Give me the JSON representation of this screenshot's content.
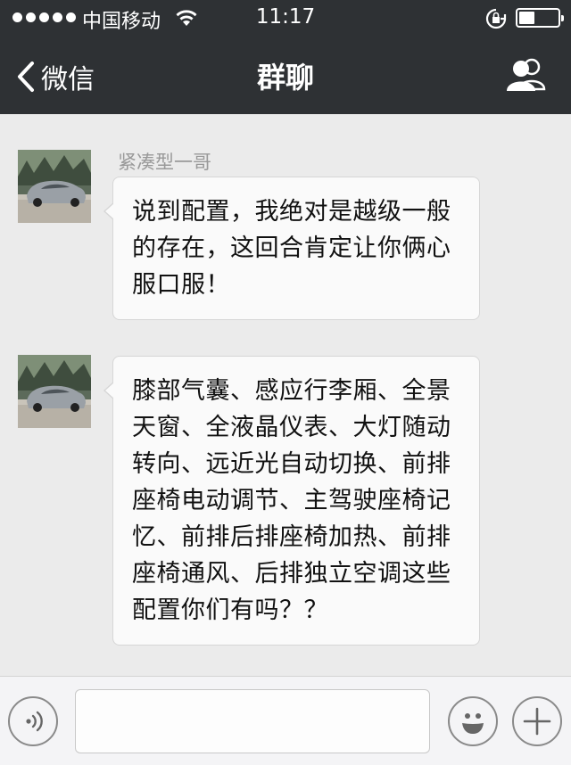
{
  "status_bar": {
    "carrier": "中国移动",
    "time": "11:17",
    "signal_bars": 5,
    "battery_level": 0.4
  },
  "nav": {
    "back_label": "微信",
    "title": "群聊"
  },
  "messages": [
    {
      "sender": "紧凑型一哥",
      "text": "说到配置，我绝对是越级一般的存在，这回合肯定让你俩心服口服！"
    },
    {
      "sender": "",
      "text": "膝部气囊、感应行李厢、全景天窗、全液晶仪表、大灯随动转向、远近光自动切换、前排座椅电动调节、主驾驶座椅记忆、前排后排座椅加热、前排座椅通风、后排独立空调这些配置你们有吗？？"
    }
  ],
  "input": {
    "placeholder": ""
  },
  "colors": {
    "nav_bg": "#2e3134",
    "chat_bg": "#ebebeb",
    "bubble_bg": "#fafafa"
  }
}
